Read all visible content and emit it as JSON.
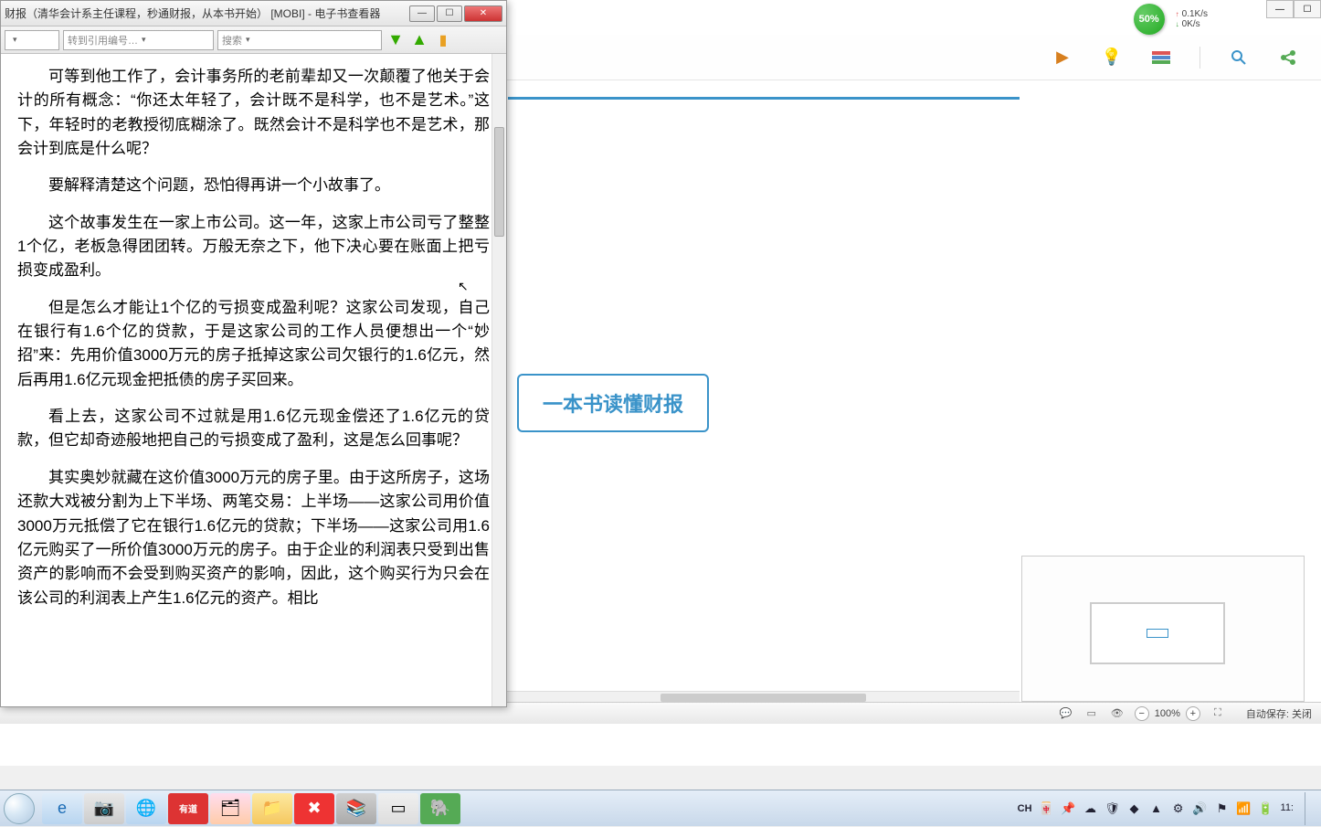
{
  "ebook": {
    "title": "财报（清华会计系主任课程，秒通财报，从本书开始）  [MOBI] - 电子书查看器",
    "toolbar": {
      "goto_placeholder": "转到引用编号…",
      "search_placeholder": "搜索"
    },
    "paragraphs": [
      "可等到他工作了，会计事务所的老前辈却又一次颠覆了他关于会计的所有概念：“你还太年轻了，会计既不是科学，也不是艺术。”这下，年轻时的老教授彻底糊涂了。既然会计不是科学也不是艺术，那会计到底是什么呢？",
      "要解释清楚这个问题，恐怕得再讲一个小故事了。",
      "这个故事发生在一家上市公司。这一年，这家上市公司亏了整整1个亿，老板急得团团转。万般无奈之下，他下决心要在账面上把亏损变成盈利。",
      "但是怎么才能让1个亿的亏损变成盈利呢？这家公司发现，自己在银行有1.6个亿的贷款，于是这家公司的工作人员便想出一个“妙招”来：先用价值3000万元的房子抵掉这家公司欠银行的1.6亿元，然后再用1.6亿元现金把抵债的房子买回来。",
      "看上去，这家公司不过就是用1.6亿元现金偿还了1.6亿元的贷款，但它却奇迹般地把自己的亏损变成了盈利，这是怎么回事呢？",
      "其实奥妙就藏在这价值3000万元的房子里。由于这所房子，这场还款大戏被分割为上下半场、两笔交易：上半场——这家公司用价值3000万元抵偿了它在银行1.6亿元的贷款；下半场——这家公司用1.6亿元购买了一所价值3000万元的房子。由于企业的利润表只受到出售资产的影响而不会受到购买资产的影响，因此，这个购买行为只会在该公司的利润表上产生1.6亿元的资产。相比"
    ]
  },
  "presentation": {
    "slide_text": "一本书读懂财报",
    "status": {
      "zoom_value": "100%",
      "autosave": "自动保存: 关闭"
    }
  },
  "net": {
    "percent": "50%",
    "up": "0.1K/s",
    "down": "0K/s"
  },
  "systray": {
    "ime": "CH",
    "time": "11:",
    "show_desktop_char": ""
  },
  "taskbar": {
    "youdao_label": "有道"
  }
}
